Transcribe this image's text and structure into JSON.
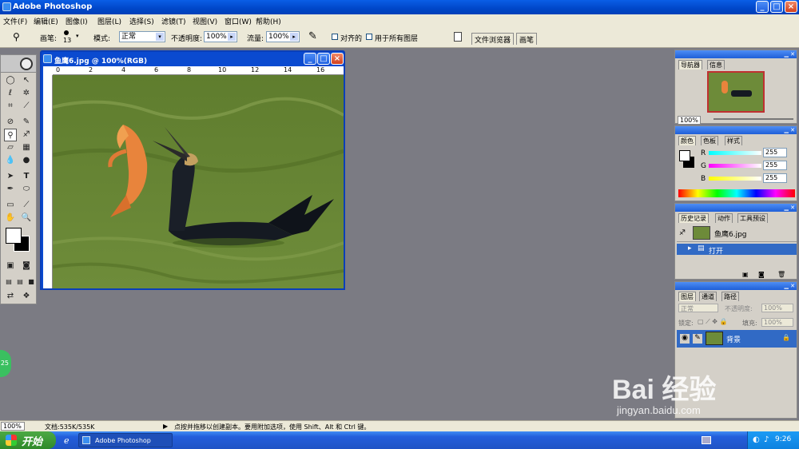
{
  "app": {
    "title": "Adobe Photoshop"
  },
  "menu": [
    "文件(F)",
    "编辑(E)",
    "图像(I)",
    "图层(L)",
    "选择(S)",
    "滤镜(T)",
    "视图(V)",
    "窗口(W)",
    "帮助(H)"
  ],
  "options": {
    "brush_label": "画笔:",
    "brush_size": "13",
    "mode_label": "模式:",
    "mode_value": "正常",
    "opacity_label": "不透明度:",
    "opacity_value": "100%",
    "flow_label": "流量:",
    "flow_value": "100%",
    "aligned_label": "对齐的",
    "use_all_layers_label": "用于所有图层",
    "tab_file_browser": "文件浏览器",
    "tab_brushes": "画笔"
  },
  "document": {
    "title": "鱼鹰6.jpg @ 100%(RGB)",
    "ruler_ticks": [
      "0",
      "2",
      "4",
      "6",
      "8",
      "10",
      "12",
      "14",
      "16"
    ]
  },
  "navigator": {
    "tab1": "导航器",
    "tab2": "信息",
    "zoom": "100%"
  },
  "color_panel": {
    "tab1": "颜色",
    "tab2": "色板",
    "tab3": "样式",
    "r_label": "R",
    "g_label": "G",
    "b_label": "B",
    "r_value": "255",
    "g_value": "255",
    "b_value": "255"
  },
  "history_panel": {
    "tab1": "历史记录",
    "tab2": "动作",
    "tab3": "工具预设",
    "snapshot": "鱼鹰6.jpg",
    "step": "打开"
  },
  "layers_panel": {
    "tab1": "图层",
    "tab2": "通道",
    "tab3": "路径",
    "blend_mode": "正常",
    "opacity_label": "不透明度:",
    "opacity_value": "100%",
    "lock_label": "锁定:",
    "fill_label": "填充:",
    "fill_value": "100%",
    "layer_name": "背景"
  },
  "status": {
    "zoom": "100%",
    "doc_size": "文档:535K/535K",
    "hint": "点按并拖移以创建副本。要用附加选项，使用 Shift、Alt 和 Ctrl 键。"
  },
  "taskbar": {
    "start": "开始",
    "task": "Adobe Photoshop",
    "clock": "9:26"
  },
  "overlay": {
    "badge": "25",
    "watermark_top": "Bai  经验",
    "watermark_bottom": "jingyan.baidu.com"
  }
}
